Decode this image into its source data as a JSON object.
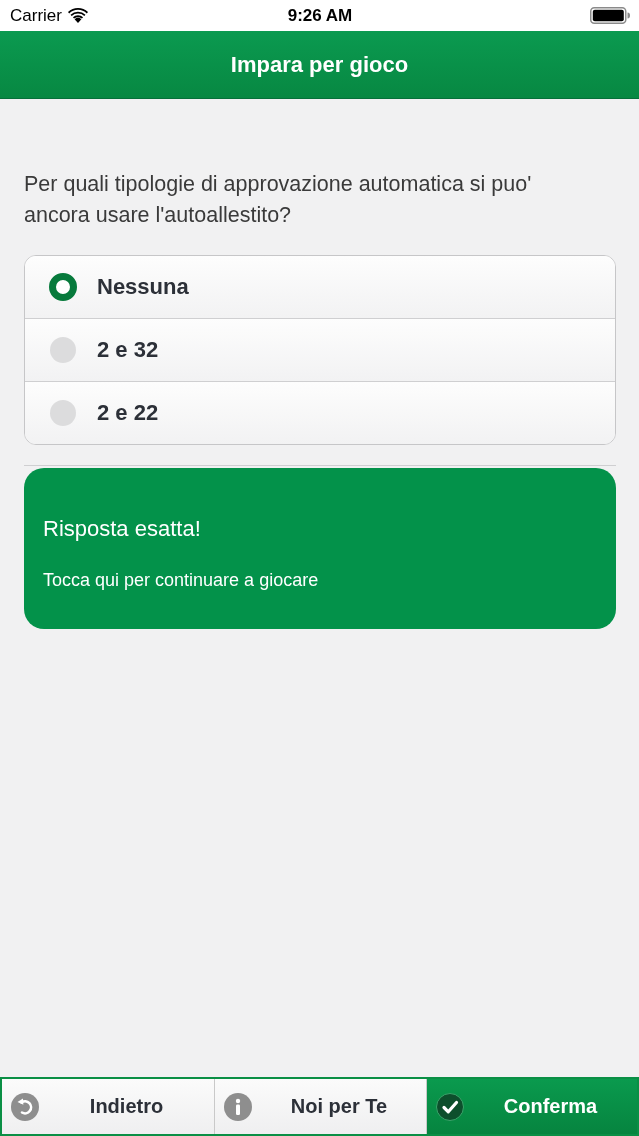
{
  "status_bar": {
    "carrier": "Carrier",
    "time": "9:26 AM"
  },
  "header": {
    "title": "Impara per gioco"
  },
  "question": {
    "text": "Per quali tipologie di approvazione automatica si puo' ancora usare l'autoallestito?"
  },
  "options": [
    {
      "label": "Nessuna",
      "selected": true
    },
    {
      "label": "2 e 32",
      "selected": false
    },
    {
      "label": "2 e 22",
      "selected": false
    }
  ],
  "result": {
    "title": "Risposta esatta!",
    "message": "Tocca qui per continuare a giocare"
  },
  "toolbar": [
    {
      "kind": "back",
      "label": "Indietro",
      "highlighted": false
    },
    {
      "kind": "info",
      "label": "Noi per Te",
      "highlighted": false
    },
    {
      "kind": "confirm",
      "label": "Conferma",
      "highlighted": true
    }
  ]
}
